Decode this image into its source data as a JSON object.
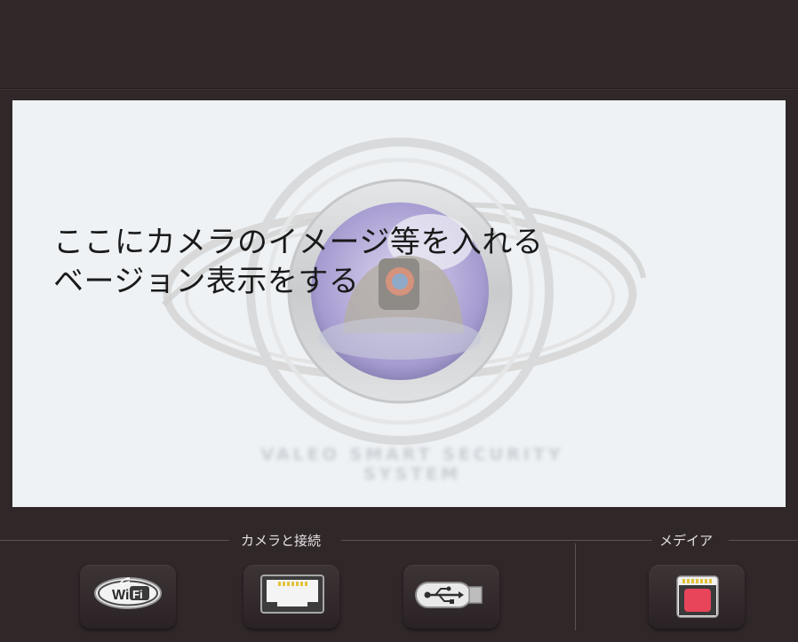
{
  "splash": {
    "placeholder_line1": "ここにカメラのイメージ等を入れる",
    "placeholder_line2": "ベージョン表示をする",
    "tagline": "VALEO SMART SECURITY SYSTEM"
  },
  "sections": {
    "camera_connection_label": "カメラと接続",
    "media_label": "メデイア"
  },
  "buttons": {
    "wifi_text_wi": "Wi",
    "wifi_text_fi": "Fi"
  },
  "colors": {
    "background": "#302729",
    "splash_bg": "#eef2f5",
    "sd_card_red": "#e8455a"
  }
}
